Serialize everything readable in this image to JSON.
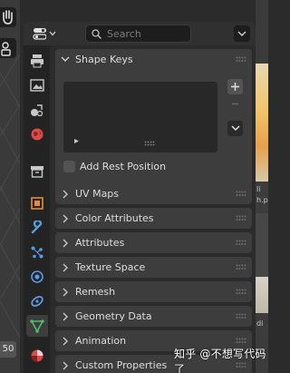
{
  "viewport": {
    "frame_number": "50"
  },
  "header": {
    "search_placeholder": "Search"
  },
  "tabs": [
    {
      "name": "tab-tool",
      "icon": "printer-icon"
    },
    {
      "name": "tab-render",
      "icon": "image-icon"
    },
    {
      "name": "tab-output",
      "icon": "scene-icon"
    },
    {
      "name": "tab-world",
      "icon": "world-icon"
    },
    {
      "name": "tab-collection",
      "icon": "box-icon"
    },
    {
      "name": "tab-object",
      "icon": "object-icon"
    },
    {
      "name": "tab-modifiers",
      "icon": "wrench-icon"
    },
    {
      "name": "tab-particles",
      "icon": "particles-icon"
    },
    {
      "name": "tab-physics",
      "icon": "physics-icon"
    },
    {
      "name": "tab-constraints",
      "icon": "constraint-icon"
    },
    {
      "name": "tab-data",
      "icon": "mesh-data-icon",
      "active": true
    },
    {
      "name": "tab-material",
      "icon": "material-icon"
    }
  ],
  "shape_keys": {
    "title": "Shape Keys",
    "add_rest_position_label": "Add Rest Position",
    "add_rest_position_checked": false
  },
  "panels": [
    {
      "title": "UV Maps"
    },
    {
      "title": "Color Attributes"
    },
    {
      "title": "Attributes"
    },
    {
      "title": "Texture Space"
    },
    {
      "title": "Remesh"
    },
    {
      "title": "Geometry Data"
    },
    {
      "title": "Animation"
    },
    {
      "title": "Custom Properties"
    }
  ],
  "background_fragments": [
    "li",
    "h.p",
    "di"
  ],
  "watermark": "知乎 @不想写代码了",
  "colors": {
    "panel_bg": "#3d3d3d",
    "editor_bg": "#2b2b2b",
    "tabs_bg": "#232323",
    "data_tab_green": "#4fbf6a",
    "blue_icon": "#5a9ae0",
    "orange_icon": "#e48a3a",
    "red_icon": "#d94a4a"
  }
}
